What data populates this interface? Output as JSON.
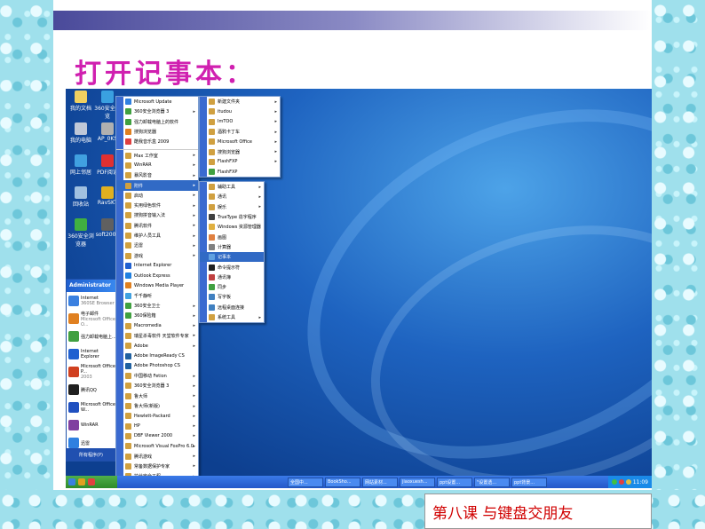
{
  "slide": {
    "title": "打开记事本：",
    "caption": "第八课  与键盘交朋友"
  },
  "desktop_icons": [
    {
      "label": "我的文档",
      "color": "#f0d060"
    },
    {
      "label": "360安全浏览",
      "color": "#3aa0e0"
    },
    {
      "label": "我的电脑",
      "color": "#c0c8d8"
    },
    {
      "label": "AP_0KS",
      "color": "#b0b0b0"
    },
    {
      "label": "网上邻居",
      "color": "#40a0e0"
    },
    {
      "label": "PDF阅读",
      "color": "#e03030"
    },
    {
      "label": "回收站",
      "color": "#a0c0e0"
    },
    {
      "label": "RavSKT",
      "color": "#e0b020"
    },
    {
      "label": "360安全浏览器",
      "color": "#40b040"
    },
    {
      "label": "soft2009",
      "color": "#606060"
    }
  ],
  "start_menu": {
    "user": "Administrator",
    "items": [
      {
        "title": "Internet",
        "sub": "360SE Browser",
        "color": "#3a80e0"
      },
      {
        "title": "电子邮件",
        "sub": "Microsoft Office O...",
        "color": "#e08020"
      },
      {
        "title": "强力卸载电脑上...",
        "sub": "",
        "color": "#40a040"
      },
      {
        "title": "Internet Explorer",
        "sub": "",
        "color": "#2060d0"
      },
      {
        "title": "Microsoft Office P...",
        "sub": "2003",
        "color": "#d04020"
      },
      {
        "title": "腾讯QQ",
        "sub": "",
        "color": "#202020"
      },
      {
        "title": "Microsoft Office W...",
        "sub": "",
        "color": "#2050c0"
      },
      {
        "title": "WinRAR",
        "sub": "",
        "color": "#8040a0"
      },
      {
        "title": "迅雷",
        "sub": "",
        "color": "#3080e0"
      }
    ],
    "all_programs": "所有程序(P)"
  },
  "menu1": [
    {
      "label": "Microsoft Update",
      "color": "#3080e0",
      "arrow": false
    },
    {
      "label": "360安全浏览器 3",
      "color": "#40a040",
      "arrow": true
    },
    {
      "label": "强力卸载电脑上的软件",
      "color": "#40a040",
      "arrow": false
    },
    {
      "label": "搜狗浏览器",
      "color": "#e08020",
      "arrow": false
    },
    {
      "label": "酷我音乐盒 2009",
      "color": "#e04040",
      "arrow": false
    },
    {
      "label": "",
      "color": "",
      "arrow": false
    },
    {
      "label": "Max 工作室",
      "color": "#d0a040",
      "arrow": true
    },
    {
      "label": "WinRAR",
      "color": "#d0a040",
      "arrow": true
    },
    {
      "label": "暴风影音",
      "color": "#d0a040",
      "arrow": true
    },
    {
      "label": "附件",
      "color": "#d0a040",
      "arrow": true,
      "hl": true
    },
    {
      "label": "启动",
      "color": "#d0a040",
      "arrow": true
    },
    {
      "label": "实用绿色软件",
      "color": "#d0a040",
      "arrow": true
    },
    {
      "label": "搜狗拼音输入法",
      "color": "#d0a040",
      "arrow": true
    },
    {
      "label": "腾讯软件",
      "color": "#d0a040",
      "arrow": true
    },
    {
      "label": "维护人员工具",
      "color": "#d0a040",
      "arrow": true
    },
    {
      "label": "迅雷",
      "color": "#d0a040",
      "arrow": true
    },
    {
      "label": "游戏",
      "color": "#d0a040",
      "arrow": true
    },
    {
      "label": "Internet Explorer",
      "color": "#2060d0",
      "arrow": false
    },
    {
      "label": "Outlook Express",
      "color": "#2080e0",
      "arrow": false
    },
    {
      "label": "Windows Media Player",
      "color": "#e08020",
      "arrow": false
    },
    {
      "label": "千千静听",
      "color": "#40a0e0",
      "arrow": false
    },
    {
      "label": "360安全卫士",
      "color": "#40a040",
      "arrow": true
    },
    {
      "label": "360保险箱",
      "color": "#40a040",
      "arrow": true
    },
    {
      "label": "Macromedia",
      "color": "#d0a040",
      "arrow": true
    },
    {
      "label": "瑞星杀毒软件 天堂软件专家",
      "color": "#d0a040",
      "arrow": true
    },
    {
      "label": "Adobe",
      "color": "#d0a040",
      "arrow": true
    },
    {
      "label": "Adobe ImageReady CS",
      "color": "#2060a0",
      "arrow": false
    },
    {
      "label": "Adobe Photoshop CS",
      "color": "#2060a0",
      "arrow": false
    },
    {
      "label": "中国移动 Fetion",
      "color": "#d0a040",
      "arrow": true
    },
    {
      "label": "360安全浏览器 3",
      "color": "#d0a040",
      "arrow": true
    },
    {
      "label": "鲁大师",
      "color": "#d0a040",
      "arrow": true
    },
    {
      "label": "鲁大师(新版)",
      "color": "#d0a040",
      "arrow": true
    },
    {
      "label": "Hewlett-Packard",
      "color": "#d0a040",
      "arrow": true
    },
    {
      "label": "HP",
      "color": "#d0a040",
      "arrow": true
    },
    {
      "label": "DBF Viewer 2000",
      "color": "#d0a040",
      "arrow": true
    },
    {
      "label": "Microsoft Visual FoxPro 6.0",
      "color": "#d0a040",
      "arrow": true
    },
    {
      "label": "腾讯游戏",
      "color": "#d0a040",
      "arrow": true
    },
    {
      "label": "常备数据保护专家",
      "color": "#d0a040",
      "arrow": true
    },
    {
      "label": "拉丝安全工程",
      "color": "#d0a040",
      "arrow": true
    }
  ],
  "menu2": [
    {
      "label": "新建文件夹",
      "color": "#d0a040",
      "arrow": true
    },
    {
      "label": "itudou",
      "color": "#d0a040",
      "arrow": true
    },
    {
      "label": "ImTOO",
      "color": "#d0a040",
      "arrow": true
    },
    {
      "label": "酒鸦卡丁车",
      "color": "#d0a040",
      "arrow": true
    },
    {
      "label": "Microsoft Office",
      "color": "#d0a040",
      "arrow": true
    },
    {
      "label": "搜狗浏览器",
      "color": "#d0a040",
      "arrow": true
    },
    {
      "label": "FlashFXP",
      "color": "#d0a040",
      "arrow": true
    },
    {
      "label": "FlashFXP",
      "color": "#40a040",
      "arrow": false
    }
  ],
  "menu3": [
    {
      "label": "辅助工具",
      "color": "#d0a040",
      "arrow": true
    },
    {
      "label": "通讯",
      "color": "#d0a040",
      "arrow": true
    },
    {
      "label": "娱乐",
      "color": "#d0a040",
      "arrow": true
    },
    {
      "label": "TrueType 造字程序",
      "color": "#404040",
      "arrow": false
    },
    {
      "label": "Windows 资源管理器",
      "color": "#e0b040",
      "arrow": false
    },
    {
      "label": "画图",
      "color": "#e08040",
      "arrow": false
    },
    {
      "label": "计算器",
      "color": "#808080",
      "arrow": false
    },
    {
      "label": "记事本",
      "color": "#60a0e0",
      "arrow": false,
      "hl": true
    },
    {
      "label": "命令提示符",
      "color": "#202020",
      "arrow": false
    },
    {
      "label": "通讯簿",
      "color": "#c04040",
      "arrow": false
    },
    {
      "label": "同步",
      "color": "#40a040",
      "arrow": false
    },
    {
      "label": "写字板",
      "color": "#4080c0",
      "arrow": false
    },
    {
      "label": "远程桌面连接",
      "color": "#4080c0",
      "arrow": false
    },
    {
      "label": "系统工具",
      "color": "#d0a040",
      "arrow": true
    }
  ],
  "taskbar": {
    "buttons": [
      "全国中...",
      "BookSho...",
      "网站素材...",
      "jiaoxuesh...",
      "ppt设置...",
      "\"设置透...",
      "ppt背景..."
    ],
    "time": "11:09"
  },
  "colors": {
    "title": "#d020b0",
    "caption": "#d00000",
    "highlight": "#316ac5"
  }
}
